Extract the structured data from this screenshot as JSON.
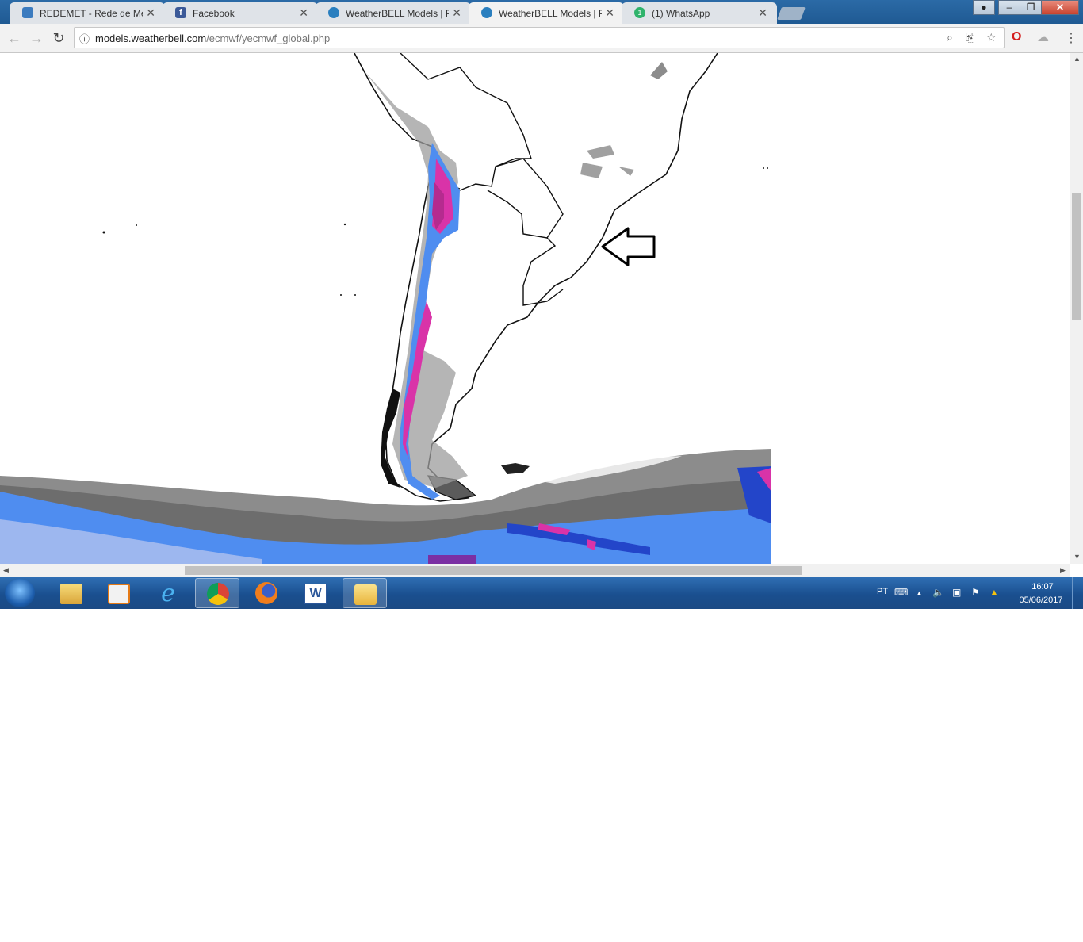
{
  "browser": {
    "tabs": [
      {
        "title": "REDEMET - Rede de Met",
        "icon": "redemet-icon",
        "active": false
      },
      {
        "title": "Facebook",
        "icon": "facebook-icon",
        "active": false
      },
      {
        "title": "WeatherBELL Models | Pr",
        "icon": "weatherbell-icon",
        "active": false
      },
      {
        "title": "WeatherBELL Models | Pr",
        "icon": "weatherbell-icon",
        "active": true
      },
      {
        "title": "(1) WhatsApp",
        "icon": "whatsapp-icon",
        "active": false
      }
    ],
    "url_host": "models.weatherbell.com",
    "url_path": "/ecmwf/yecmwf_global.php",
    "window_controls": {
      "minimize": "–",
      "maximize": "❐",
      "close": "✕"
    }
  },
  "taskbar": {
    "apps": [
      "start-orb",
      "file-explorer",
      "media-player",
      "internet-explorer",
      "chrome",
      "firefox",
      "word",
      "outlook"
    ],
    "language": "PT",
    "clock_time": "16:07",
    "clock_date": "05/06/2017"
  },
  "colors": {
    "tabstrip": "#2b6aa6",
    "precip_light": "#bfc9ee",
    "precip_blue": "#4f8df0",
    "precip_dark_blue": "#2345c9",
    "precip_magenta": "#d933a8",
    "cloud_gray": "#8a8a8a"
  }
}
